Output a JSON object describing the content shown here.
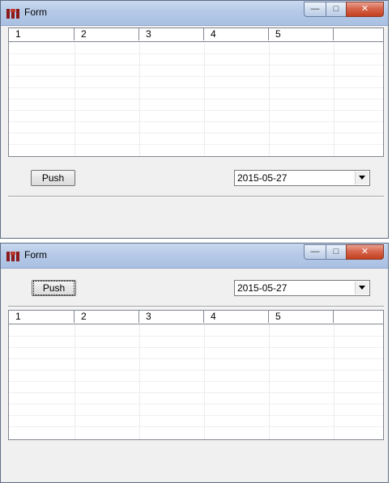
{
  "window1": {
    "title": "Form",
    "caption_buttons": {
      "minimize": "—",
      "maximize": "□",
      "close": "✕"
    },
    "columns": [
      "1",
      "2",
      "3",
      "4",
      "5",
      ""
    ],
    "push_label": "Push",
    "date_value": "2015-05-27"
  },
  "window2": {
    "title": "Form",
    "caption_buttons": {
      "minimize": "—",
      "maximize": "□",
      "close": "✕"
    },
    "columns": [
      "1",
      "2",
      "3",
      "4",
      "5",
      ""
    ],
    "push_label": "Push",
    "date_value": "2015-05-27"
  },
  "colors": {
    "window_bg": "#f0f0f0",
    "titlebar": "#b7cbe8",
    "close_button": "#c2401f",
    "grid_border": "#828790"
  },
  "icons": [
    "app-logo-icon",
    "minimize-icon",
    "maximize-icon",
    "close-icon",
    "dropdown-arrow-icon"
  ]
}
